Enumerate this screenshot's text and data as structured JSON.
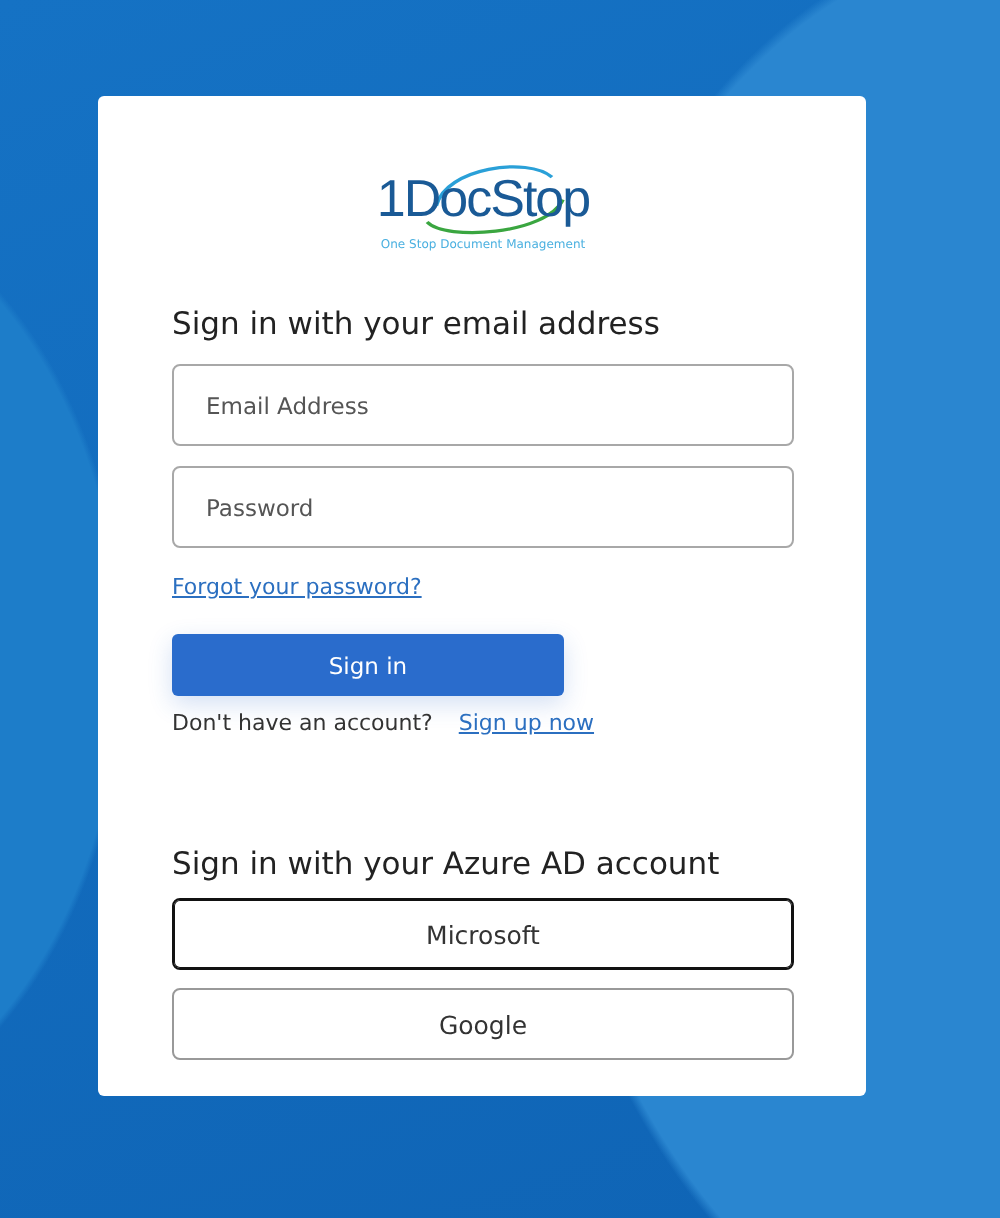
{
  "logo": {
    "name": "1DocStop",
    "tagline": "One Stop Document Management"
  },
  "local": {
    "heading": "Sign in with your email address",
    "fields": [
      {
        "placeholder": "Email Address"
      },
      {
        "placeholder": "Password"
      }
    ],
    "forgot_link": "Forgot your password?",
    "submit": "Sign in",
    "signup_prompt": "Don't have an account?",
    "signup_link": "Sign up now"
  },
  "social": {
    "heading": "Sign in with your Azure AD account",
    "providers": [
      {
        "label": "Microsoft",
        "selected": true
      },
      {
        "label": "Google",
        "selected": false
      }
    ]
  }
}
